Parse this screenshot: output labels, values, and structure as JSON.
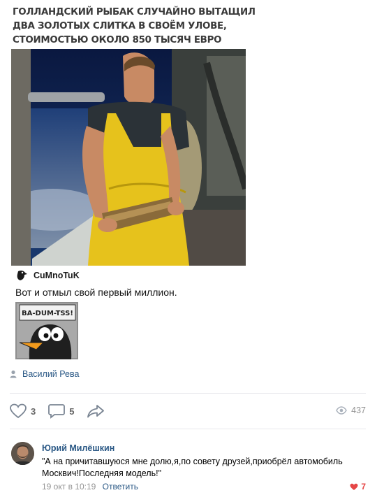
{
  "post": {
    "headline": [
      "ГОЛЛАНДСКИЙ РЫБАК СЛУЧАЙНО ВЫТАЩИЛ",
      "ДВА ЗОЛОТЫХ СЛИТКА В СВОЁМ УЛОВЕ,",
      "СТОИМОСТЬЮ ОКОЛО 850 ТЫСЯЧ ЕВРО"
    ],
    "caption_name": "CuMnoTuK",
    "text": "Вот и отмыл свой первый миллион.",
    "sticker_text": "BA-DUM-TSS!",
    "author": "Василий Рева",
    "likes": "3",
    "comments": "5",
    "views": "437"
  },
  "comment": {
    "author": "Юрий Милёшкин",
    "text": "\"А на причитавшуюся мне долю,я,по совету друзей,приобрёл автомобиль Москвич!Последняя модель!\"",
    "date": "19 окт в 10:19",
    "reply_label": "Ответить",
    "likes": "7"
  },
  "colors": {
    "link": "#2a5885",
    "muted": "#939393",
    "like_red": "#e64646"
  }
}
